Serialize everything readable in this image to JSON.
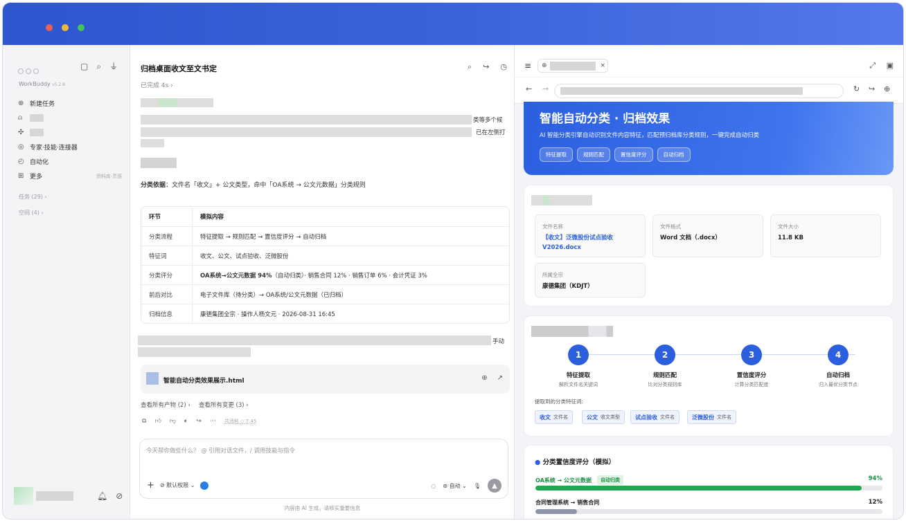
{
  "sidebar": {
    "brand": "WorkBuddy",
    "version": "v5.2.8",
    "items": [
      {
        "label": "新建任务",
        "icon": "plus-circle-icon"
      },
      {
        "label": "",
        "icon": "robot-icon"
      },
      {
        "label": "",
        "icon": "puzzle-icon"
      },
      {
        "label": "专家·技能·连接器",
        "icon": "expert-icon"
      },
      {
        "label": "自动化",
        "icon": "clock-icon"
      },
      {
        "label": "更多",
        "icon": "grid-icon",
        "extra": "资料库·灵感"
      }
    ],
    "tasks": "任务 (29)",
    "spaces": "空间 (4)"
  },
  "chat": {
    "title": "归档桌面收文至文书定",
    "status": "已完成 4s",
    "line1_tail": "类等多个候",
    "line2_tail": "已在左侧打",
    "basis_label": "分类依据",
    "basis_text": "：文件名「收文」+ 公文类型，命中「OA系统 → 公文元数据」分类规则",
    "table_header": [
      "环节",
      "模拟内容"
    ],
    "table_rows": [
      [
        "分类流程",
        "特征提取 → 规则匹配 → 置信度评分 → 自动归档"
      ],
      [
        "特征词",
        "收文、公文、试点验收、泛微股份"
      ],
      [
        "分类评分",
        "OA系统→公文元数据 94%（自动归类）· 销售合同 12% · 销售订单 6% · 会计凭证 3%"
      ],
      [
        "前后对比",
        "电子文件库（待分类）→ OA系统/公文元数据（已归档）"
      ],
      [
        "归档信息",
        "康德集团全宗 · 操作人杨文元 · 2026-08-31 16:45"
      ]
    ],
    "row3_bold": "OA系统→公文元数据 94%",
    "row3_rest": "（自动归类）· 销售合同 12% · 销售订单 6% · 会计凭证 3%",
    "line3_tail": "手动",
    "file_name": "智能自动分类效果展示.html",
    "link_artifacts": "查看所有产物 (2)",
    "link_changes": "查看所有变更 (3)",
    "cost": "共消耗 ◇ 7.45",
    "input_placeholder": "今天帮你做些什么？ @ 引用对话文件，/ 调用技能与指令",
    "permission": "默认权限",
    "mode": "自动",
    "footer": "内容由 AI 生成，请核实重要信息"
  },
  "preview": {
    "hero_title": "智能自动分类 · 归档效果",
    "hero_desc": "AI 智能分类引擎自动识别文件内容特征，匹配预归档库分类规则，一键完成自动归类",
    "pills": [
      "特征提取",
      "规则匹配",
      "置信度评分",
      "自动归档"
    ],
    "meta": [
      {
        "label": "文件名称",
        "value": "【收文】泛微股份试点验收V2026.docx"
      },
      {
        "label": "文件格式",
        "value": "Word 文档（.docx）"
      },
      {
        "label": "文件大小",
        "value": "11.8 KB"
      },
      {
        "label": "所属全宗",
        "value": "康德集团（KDJT）"
      }
    ],
    "steps": [
      {
        "num": "1",
        "title": "特征提取",
        "desc": "解析文件名关键词"
      },
      {
        "num": "2",
        "title": "规则匹配",
        "desc": "比对分类规则库"
      },
      {
        "num": "3",
        "title": "置信度评分",
        "desc": "计算分类匹配度"
      },
      {
        "num": "4",
        "title": "自动归档",
        "desc": "归入最优分类节点"
      }
    ],
    "keywords_label": "提取到的分类特征词:",
    "keywords": [
      {
        "word": "收文",
        "type": "文件名"
      },
      {
        "word": "公文",
        "type": "收文类型"
      },
      {
        "word": "试点验收",
        "type": "文件名"
      },
      {
        "word": "泛微股份",
        "type": "文件名"
      }
    ],
    "score_title": "分类置信度评分（模拟）",
    "scores": [
      {
        "label": "OA系统 → 公文元数据",
        "badge": "自动归类",
        "value": "94%",
        "fraction": 0.94,
        "color": "#1fa850"
      },
      {
        "label": "合同管理系统 → 销售合同",
        "badge": "",
        "value": "12%",
        "fraction": 0.12,
        "color": "#8d96a8"
      }
    ]
  }
}
